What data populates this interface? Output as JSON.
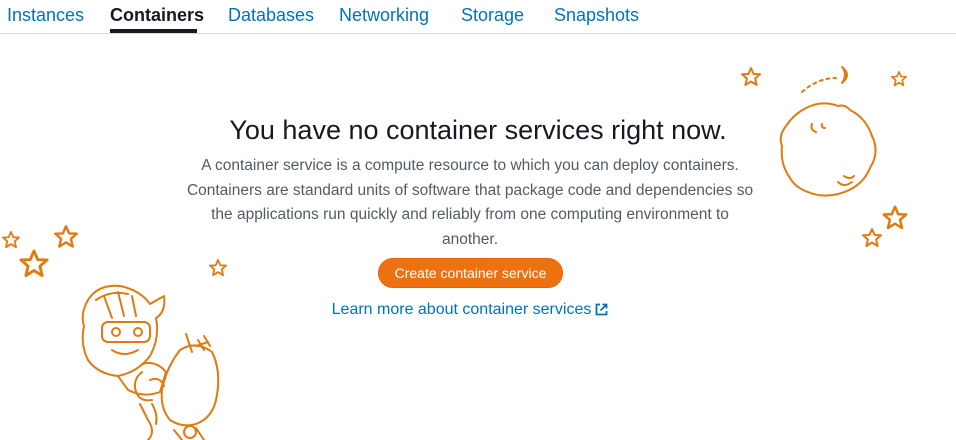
{
  "tabs": [
    {
      "label": "Instances",
      "active": false
    },
    {
      "label": "Containers",
      "active": true
    },
    {
      "label": "Databases",
      "active": false
    },
    {
      "label": "Networking",
      "active": false
    },
    {
      "label": "Storage",
      "active": false
    },
    {
      "label": "Snapshots",
      "active": false
    }
  ],
  "empty_state": {
    "title": "You have no container services right now.",
    "description_lines": [
      "A container service is a compute resource to which you can deploy containers.",
      "Containers are standard units of software that package code and dependencies so",
      "the applications run quickly and reliably from one computing environment to",
      "another."
    ],
    "create_button_label": "Create container service",
    "learn_more_label": "Learn more about container services",
    "external_link_icon": "external-link-icon"
  },
  "illustration": {
    "stroke_color": "#e07b12",
    "elements": [
      "star-icon",
      "moon-icon",
      "planet-icon",
      "robot-icon"
    ]
  },
  "colors": {
    "link": "#0073bb",
    "active_tab": "#16191f",
    "button_bg": "#ec7211",
    "body_text": "#545b64"
  }
}
